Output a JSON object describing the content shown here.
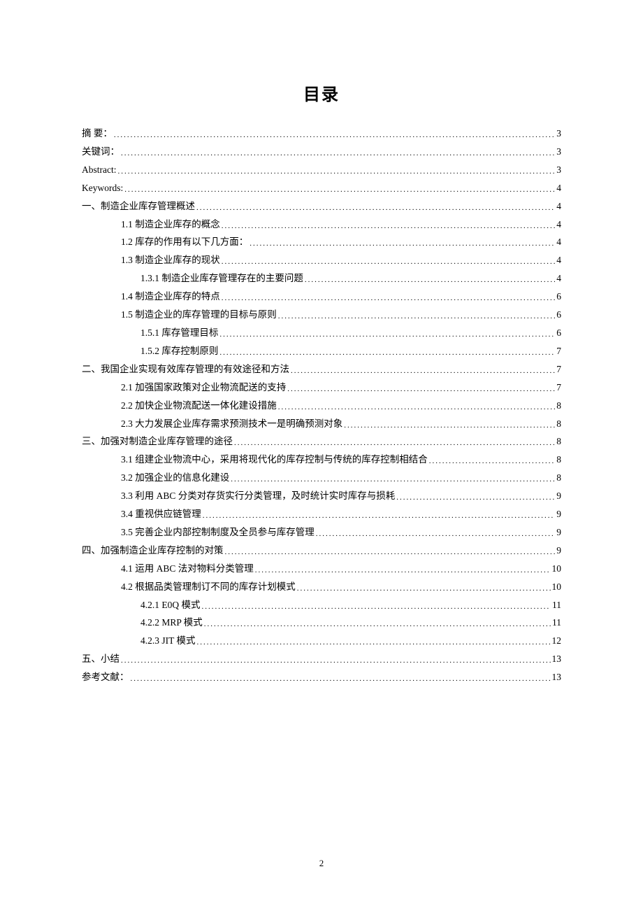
{
  "title": "目录",
  "pageNumber": "2",
  "entries": [
    {
      "label": "摘 要：",
      "page": "3",
      "indent": 0
    },
    {
      "label": "关键词：",
      "page": "3",
      "indent": 0
    },
    {
      "label": "Abstract:",
      "page": "3",
      "indent": 0
    },
    {
      "label": "Keywords:",
      "page": "4",
      "indent": 0
    },
    {
      "label": "一、制造企业库存管理概述",
      "page": "4",
      "indent": 0
    },
    {
      "label": "1.1 制造企业库存的概念",
      "page": "4",
      "indent": 1
    },
    {
      "label": "1.2 库存的作用有以下几方面：",
      "page": "4",
      "indent": 1
    },
    {
      "label": "1.3 制造企业库存的现状",
      "page": "4",
      "indent": 1
    },
    {
      "label": "1.3.1 制造企业库存管理存在的主要问题",
      "page": "4",
      "indent": 2
    },
    {
      "label": "1.4 制造企业库存的特点",
      "page": "6",
      "indent": 1
    },
    {
      "label": "1.5 制造企业的库存管理的目标与原则",
      "page": "6",
      "indent": 1
    },
    {
      "label": "1.5.1  库存管理目标",
      "page": "6",
      "indent": 2
    },
    {
      "label": "1.5.2 库存控制原则",
      "page": "7",
      "indent": 2
    },
    {
      "label": "二、我国企业实现有效库存管理的有效途径和方法",
      "page": "7",
      "indent": 0
    },
    {
      "label": "2.1 加强国家政策对企业物流配送的支持",
      "page": "7",
      "indent": 1
    },
    {
      "label": "2.2 加快企业物流配送一体化建设措施",
      "page": "8",
      "indent": 1
    },
    {
      "label": "2.3 大力发展企业库存需求预测技术一是明确预测对象",
      "page": "8",
      "indent": 1
    },
    {
      "label": "三、加强对制造企业库存管理的途径",
      "page": "8",
      "indent": 0
    },
    {
      "label": "3.1 组建企业物流中心，采用将现代化的库存控制与传统的库存控制相结合",
      "page": "8",
      "indent": 1
    },
    {
      "label": "3.2 加强企业的信息化建设",
      "page": "8",
      "indent": 1
    },
    {
      "label": "3.3 利用 ABC 分类对存货实行分类管理，及时统计实时库存与损耗 ",
      "page": "9",
      "indent": 1
    },
    {
      "label": "3.4 重视供应链管理",
      "page": "9",
      "indent": 1
    },
    {
      "label": "3.5 完善企业内部控制制度及全员参与库存管理",
      "page": "9",
      "indent": 1
    },
    {
      "label": "四、加强制造企业库存控制的对策",
      "page": "9",
      "indent": 0
    },
    {
      "label": "4.1 运用 ABC 法对物料分类管理 ",
      "page": "10",
      "indent": 1
    },
    {
      "label": "4.2 根据品类管理制订不同的库存计划模式",
      "page": "10",
      "indent": 1
    },
    {
      "label": "4.2.1    E0Q 模式 ",
      "page": "11",
      "indent": 2
    },
    {
      "label": "4.2.2 MRP 模式 ",
      "page": "11",
      "indent": 2
    },
    {
      "label": "4.2.3 JIT 模式 ",
      "page": "12",
      "indent": 2
    },
    {
      "label": "五、小结",
      "page": "13",
      "indent": 0
    },
    {
      "label": "参考文献：",
      "page": "13",
      "indent": 0
    }
  ]
}
